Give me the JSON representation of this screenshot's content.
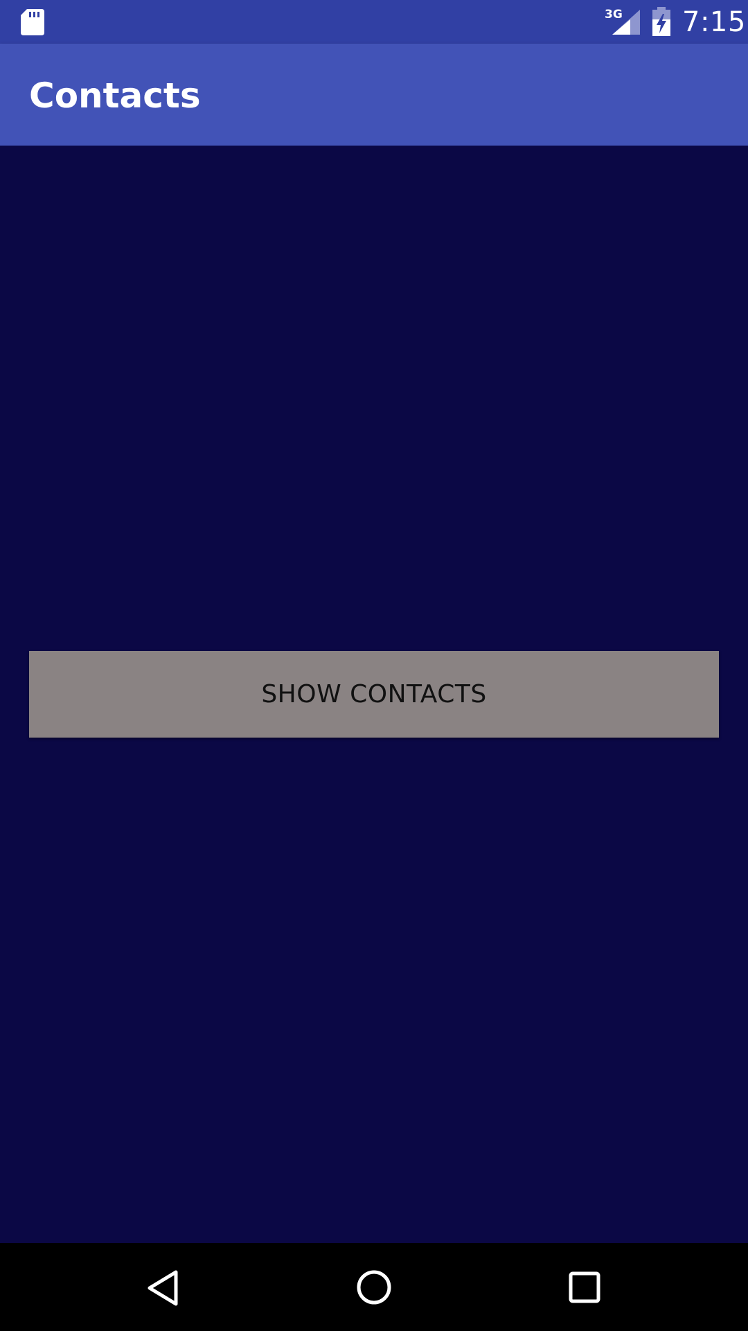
{
  "status_bar": {
    "time": "7:15",
    "network_type": "3G",
    "icons": [
      "sd-card-icon",
      "signal-icon",
      "battery-charging-icon"
    ]
  },
  "app_bar": {
    "title": "Contacts"
  },
  "main": {
    "show_contacts_label": "SHOW CONTACTS"
  },
  "nav_bar": {
    "icons": [
      "back-icon",
      "home-icon",
      "recents-icon"
    ]
  },
  "colors": {
    "status_bar": "#3140a4",
    "app_bar": "#4253b7",
    "background": "#0b0845",
    "button": "#8a8383",
    "nav_bar": "#000000"
  }
}
